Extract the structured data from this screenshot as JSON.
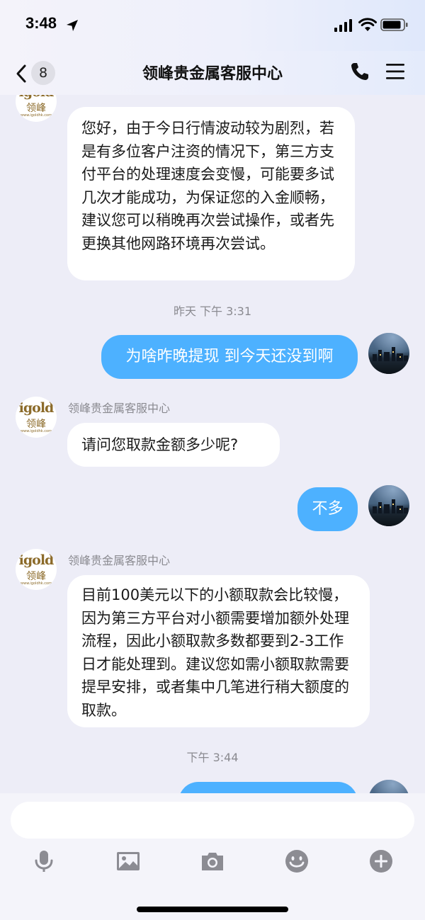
{
  "status": {
    "time": "3:48"
  },
  "nav": {
    "back_count": "8",
    "title": "领峰贵金属客服中心"
  },
  "agent": {
    "name": "领峰贵金属客服中心",
    "logo_word": "igold",
    "logo_cn": "领峰",
    "logo_url": "www.igoldhk.com"
  },
  "messages": {
    "m1": {
      "text": "您好，由于今日行情波动较为剧烈，若是有多位客户注资的情况下，第三方支付平台的处理速度会变慢，可能要多试几次才能成功，为保证您的入金顺畅，建议您可以稍晚再次尝试操作，或者先更换其他网路环境再次尝试。"
    },
    "t1": "昨天 下午 3:31",
    "m2": {
      "text": "为啥昨晚提现 到今天还没到啊"
    },
    "m3": {
      "sender": "领峰贵金属客服中心",
      "text": "请问您取款金额多少呢?"
    },
    "m4": {
      "text": "不多"
    },
    "m5": {
      "sender": "领峰贵金属客服中心",
      "text": "目前100美元以下的小额取款会比较慢，因为第三方平台对小额需要增加额外处理流程，因此小额取款多数都要到2-3工作日才能处理到。建议您如需小额取款需要提早安排，或者集中几笔进行稍大额度的取款。"
    },
    "t2": "下午 3:44"
  },
  "input": {
    "placeholder": ""
  },
  "toolbar": {
    "icons": [
      "microphone-icon",
      "image-icon",
      "camera-icon",
      "emoji-icon",
      "plus-icon"
    ]
  },
  "colors": {
    "accent": "#4db1ff",
    "background": "#ededf7"
  }
}
